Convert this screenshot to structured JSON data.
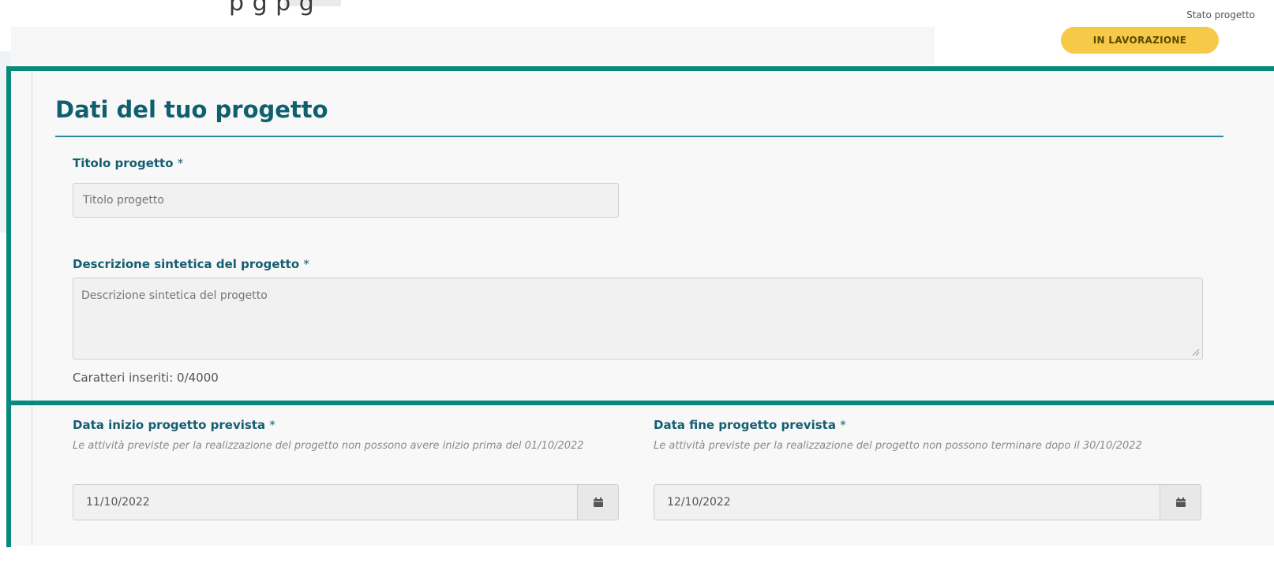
{
  "header": {
    "cut_text": "p                                    g                                    p g",
    "status_label": "Stato progetto",
    "status_badge": "IN LAVORAZIONE",
    "badge_color": "#f7c948"
  },
  "section": {
    "title": "Dati del tuo progetto",
    "accent_color": "#078a7d"
  },
  "fields": {
    "title": {
      "label": "Titolo progetto",
      "required_mark": "*",
      "placeholder": "Titolo progetto"
    },
    "description": {
      "label": "Descrizione sintetica del progetto",
      "required_mark": "*",
      "placeholder": "Descrizione sintetica del progetto",
      "char_count": "Caratteri inseriti: 0/4000"
    },
    "start_date": {
      "label": "Data inizio progetto prevista",
      "required_mark": "*",
      "hint": "Le attività previste per la realizzazione del progetto non possono avere inizio prima del 01/10/2022",
      "value": "11/10/2022",
      "icon": "calendar-icon"
    },
    "end_date": {
      "label": "Data fine progetto prevista",
      "required_mark": "*",
      "hint": "Le attività previste per la realizzazione del progetto non possono terminare dopo il 30/10/2022",
      "value": "12/10/2022",
      "icon": "calendar-icon"
    }
  }
}
